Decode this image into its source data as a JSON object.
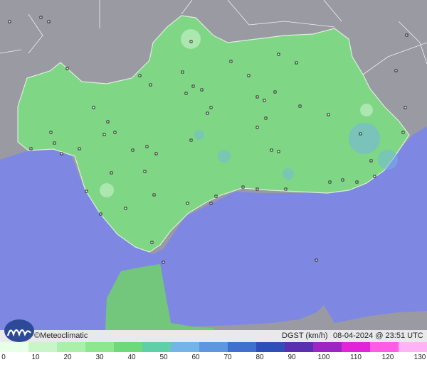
{
  "brand": {
    "name": "©Meteoclimatic",
    "logo_icon": "meteoclimatic-logo-icon"
  },
  "map": {
    "parameter": "DGST (km/h)",
    "timestamp": "08-04-2024 @ 23:51 UTC",
    "colors": {
      "sea": "#7e88e2",
      "land_other": "#9a9aa3",
      "andalusia": "#7fd685",
      "morocco": "#72c77c"
    }
  },
  "legend": {
    "labels": [
      "0",
      "10",
      "20",
      "30",
      "40",
      "50",
      "60",
      "70",
      "80",
      "90",
      "100",
      "110",
      "120",
      "130"
    ],
    "colors": [
      "#e8ffe8",
      "#c9f6c9",
      "#aaf0aa",
      "#8ee68e",
      "#6ed97a",
      "#5fcfa8",
      "#74b4e8",
      "#5e96e0",
      "#3f70cf",
      "#2f4fb8",
      "#5a2fb0",
      "#9c25c4",
      "#e224d8",
      "#ff5ce6",
      "#ffb5f5"
    ]
  }
}
